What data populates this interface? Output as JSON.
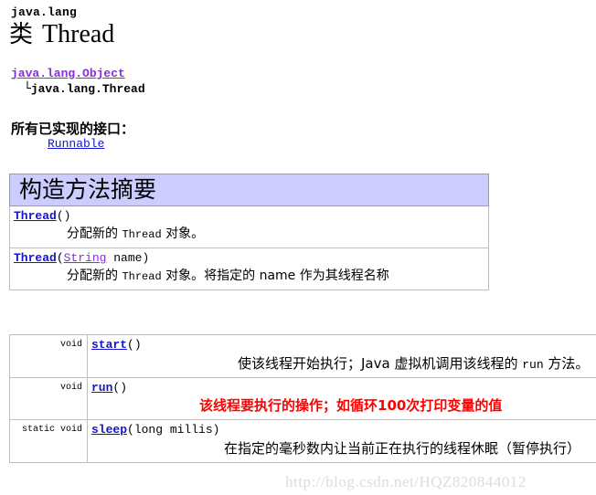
{
  "header": {
    "package": "java.lang",
    "class_keyword": "类",
    "class_name": "Thread"
  },
  "inheritance": {
    "superclass": "java.lang.Object",
    "branch_glyph": "└",
    "class_fqn": "java.lang.Thread"
  },
  "interfaces": {
    "heading": "所有已实现的接口：",
    "items": [
      "Runnable"
    ]
  },
  "constructor_summary": {
    "band_title": "构造方法摘要",
    "rows": [
      {
        "name": "Thread",
        "params_open": "(",
        "params": "",
        "params_close": ")",
        "desc_pre": "分配新的 ",
        "desc_mono": "Thread",
        "desc_post": " 对象。"
      },
      {
        "name": "Thread",
        "params_open": "(",
        "param_type": "String",
        "param_name": " name",
        "params_close": ")",
        "desc_pre": "分配新的 ",
        "desc_mono": "Thread",
        "desc_post": " 对象。将指定的 name 作为其线程名称"
      }
    ]
  },
  "method_summary": {
    "rows": [
      {
        "type": "void",
        "name": "start",
        "signature_tail": "()",
        "desc_pre": "使该线程开始执行；Java 虚拟机调用该线程的 ",
        "desc_mono": "run",
        "desc_post": " 方法。",
        "highlight": false
      },
      {
        "type": "void",
        "name": "run",
        "signature_tail": "()",
        "desc_full": "该线程要执行的操作；如循环100次打印变量的值",
        "highlight": true,
        "highlight_color": "#FF0000"
      },
      {
        "type": "static void",
        "name": "sleep",
        "signature_tail": "(long millis)",
        "desc_full": "在指定的毫秒数内让当前正在执行的线程休眠（暂停执行）",
        "highlight": false
      }
    ]
  },
  "watermark": {
    "text": "http://blog.csdn.net/HQZ820844012"
  },
  "colors": {
    "link": "#1414CC",
    "visited_link": "#8A2BE2",
    "band_background": "#CCCCFF",
    "table_border": "#BFBFBF",
    "annotation_red": "#FF0000",
    "watermark": "#DCDCDC"
  }
}
